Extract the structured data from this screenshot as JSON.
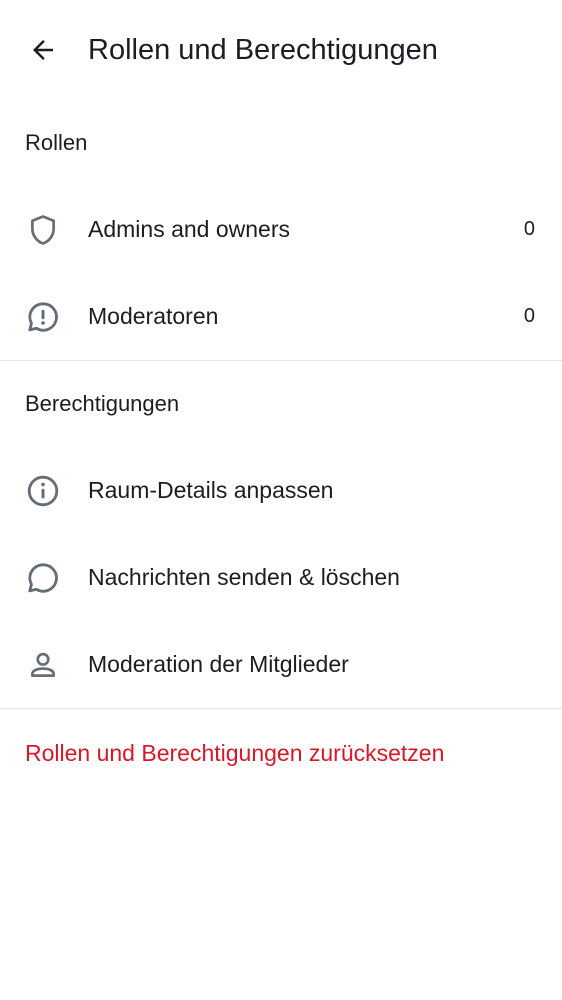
{
  "header": {
    "title": "Rollen und Berechtigungen",
    "back_icon": "arrow-left-icon"
  },
  "roles": {
    "section_title": "Rollen",
    "items": [
      {
        "icon": "shield-icon",
        "label": "Admins and owners",
        "count": "0"
      },
      {
        "icon": "chat-alert-icon",
        "label": "Moderatoren",
        "count": "0"
      }
    ]
  },
  "permissions": {
    "section_title": "Berechtigungen",
    "items": [
      {
        "icon": "info-icon",
        "label": "Raum-Details anpassen"
      },
      {
        "icon": "chat-bubble-icon",
        "label": "Nachrichten senden & löschen"
      },
      {
        "icon": "person-icon",
        "label": "Moderation der Mitglieder"
      }
    ]
  },
  "reset": {
    "label": "Rollen und Berechtigungen zurücksetzen"
  },
  "colors": {
    "text": "#1b1d22",
    "icon": "#656d77",
    "divider": "#e4e6ea",
    "danger": "#d51928"
  }
}
